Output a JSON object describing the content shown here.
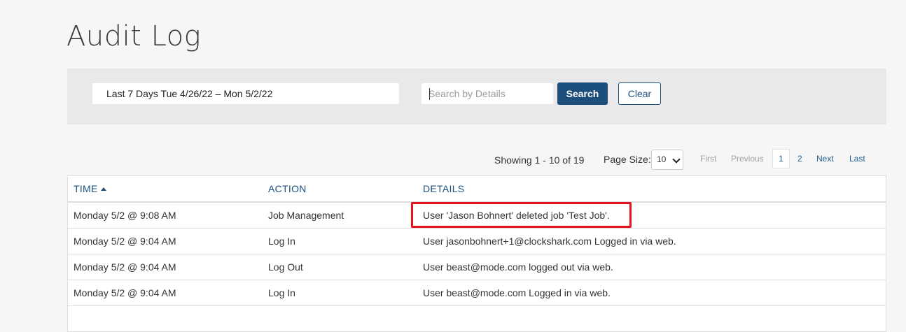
{
  "page": {
    "title": "Audit Log"
  },
  "filters": {
    "date_range": "Last 7 Days Tue 4/26/22 – Mon 5/2/22",
    "search_placeholder": "Search by Details",
    "search_label": "Search",
    "clear_label": "Clear"
  },
  "pagination": {
    "showing": "Showing 1 - 10 of 19",
    "page_size_label": "Page Size:",
    "page_size_value": "10",
    "first": "First",
    "previous": "Previous",
    "current": "1",
    "page2": "2",
    "next": "Next",
    "last": "Last"
  },
  "table": {
    "columns": {
      "time": "TIME",
      "action": "ACTION",
      "details": "DETAILS"
    },
    "rows": [
      {
        "time": "Monday 5/2 @ 9:08 AM",
        "action": "Job Management",
        "details": "User 'Jason Bohnert' deleted job 'Test Job'."
      },
      {
        "time": "Monday 5/2 @ 9:04 AM",
        "action": "Log In",
        "details": "User jasonbohnert+1@clockshark.com Logged in via web."
      },
      {
        "time": "Monday 5/2 @ 9:04 AM",
        "action": "Log Out",
        "details": "User beast@mode.com logged out via web."
      },
      {
        "time": "Monday 5/2 @ 9:04 AM",
        "action": "Log In",
        "details": "User beast@mode.com Logged in via web."
      }
    ]
  },
  "colors": {
    "primary": "#1d4f7d",
    "highlight": "#e3141b",
    "filter_bar_bg": "#e9e9e9"
  }
}
